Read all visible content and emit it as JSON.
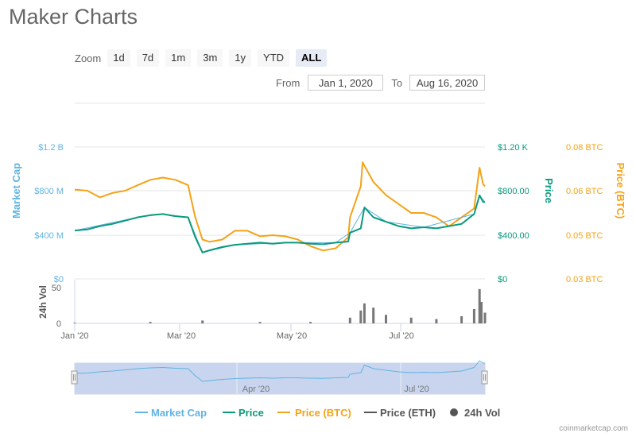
{
  "title": "Maker Charts",
  "zoom": {
    "label": "Zoom",
    "buttons": [
      "1d",
      "7d",
      "1m",
      "3m",
      "1y",
      "YTD",
      "ALL"
    ],
    "active": "ALL"
  },
  "range": {
    "from_label": "From",
    "from_value": "Jan 1, 2020",
    "to_label": "To",
    "to_value": "Aug 16, 2020"
  },
  "colors": {
    "market_cap": "#5fb4e3",
    "price": "#0a9a7d",
    "price_btc": "#f3a317",
    "price_eth": "#555555",
    "volume": "#777777",
    "navigator_fill": "#c9d5ee"
  },
  "watermark": "coinmarketcap.com",
  "chart_data": {
    "type": "line",
    "x_tick_labels": [
      "Jan '20",
      "Mar '20",
      "May '20",
      "Jul '20"
    ],
    "navigator_tick_labels": [
      "Apr '20",
      "Jul '20"
    ],
    "axes": {
      "market_cap": {
        "label": "Market Cap",
        "ticks": [
          "$1.2 B",
          "$800 M",
          "$400 M",
          "$0"
        ],
        "range": [
          0,
          1200
        ]
      },
      "price": {
        "label": "Price",
        "ticks": [
          "$1.20 K",
          "$800.00",
          "$400.00",
          "$0"
        ],
        "range": [
          0,
          1200
        ]
      },
      "price_btc": {
        "label": "Price (BTC)",
        "ticks": [
          "0.08 BTC",
          "0.06 BTC",
          "0.05 BTC",
          "0.03 BTC"
        ]
      },
      "volume": {
        "label": "24h Vol",
        "ticks": [
          "50",
          "0"
        ]
      }
    },
    "legend": {
      "placement": "bottom",
      "items": [
        "Market Cap",
        "Price",
        "Price (BTC)",
        "Price (ETH)",
        "24h Vol"
      ]
    },
    "price": {
      "dates": [
        "Jan 1",
        "Jan 8",
        "Jan 15",
        "Jan 22",
        "Jan 29",
        "Feb 5",
        "Feb 12",
        "Feb 19",
        "Feb 26",
        "Mar 4",
        "Mar 8",
        "Mar 12",
        "Mar 16",
        "Mar 23",
        "Mar 30",
        "Apr 6",
        "Apr 13",
        "Apr 20",
        "Apr 27",
        "May 4",
        "May 11",
        "May 18",
        "May 25",
        "Jun 1",
        "Jun 2",
        "Jun 8",
        "Jun 10",
        "Jun 15",
        "Jun 22",
        "Jun 29",
        "Jul 6",
        "Jul 13",
        "Jul 20",
        "Jul 27",
        "Aug 3",
        "Aug 10",
        "Aug 13",
        "Aug 15",
        "Aug 16"
      ],
      "values": [
        440,
        450,
        480,
        500,
        530,
        560,
        580,
        590,
        570,
        560,
        380,
        240,
        260,
        290,
        310,
        320,
        330,
        320,
        330,
        330,
        320,
        315,
        330,
        340,
        420,
        460,
        650,
        560,
        520,
        480,
        460,
        470,
        460,
        480,
        500,
        590,
        760,
        700,
        700
      ]
    },
    "price_btc": {
      "dates": [
        "Jan 1",
        "Jan 8",
        "Jan 15",
        "Jan 22",
        "Jan 29",
        "Feb 5",
        "Feb 12",
        "Feb 19",
        "Feb 26",
        "Mar 4",
        "Mar 8",
        "Mar 12",
        "Mar 16",
        "Mar 23",
        "Mar 30",
        "Apr 6",
        "Apr 13",
        "Apr 20",
        "Apr 27",
        "May 4",
        "May 11",
        "May 18",
        "May 25",
        "Jun 1",
        "Jun 2",
        "Jun 8",
        "Jun 9",
        "Jun 15",
        "Jun 22",
        "Jun 29",
        "Jul 6",
        "Jul 13",
        "Jul 20",
        "Jul 27",
        "Aug 3",
        "Aug 10",
        "Aug 13",
        "Aug 15",
        "Aug 16"
      ],
      "values": [
        0.0605,
        0.06,
        0.0585,
        0.0595,
        0.06,
        0.0625,
        0.065,
        0.066,
        0.065,
        0.0625,
        0.054,
        0.048,
        0.047,
        0.048,
        0.051,
        0.051,
        0.0495,
        0.05,
        0.0495,
        0.048,
        0.045,
        0.043,
        0.044,
        0.049,
        0.054,
        0.062,
        0.073,
        0.064,
        0.059,
        0.057,
        0.055,
        0.055,
        0.054,
        0.052,
        0.054,
        0.056,
        0.0705,
        0.063,
        0.062
      ]
    },
    "market_cap": {
      "dates": [
        "Jan 1",
        "Feb 5",
        "Feb 19",
        "Mar 4",
        "Mar 12",
        "Mar 30",
        "Apr 27",
        "May 25",
        "Jun 2",
        "Jun 10",
        "Jun 22",
        "Jul 13",
        "Aug 10",
        "Aug 13",
        "Aug 16"
      ],
      "values": [
        440,
        560,
        590,
        560,
        240,
        310,
        330,
        330,
        420,
        650,
        520,
        470,
        590,
        760,
        700
      ]
    },
    "volume": {
      "dates": [
        "Jan 1",
        "Feb 12",
        "Mar 12",
        "Apr 13",
        "May 11",
        "Jun 2",
        "Jun 8",
        "Jun 10",
        "Jun 15",
        "Jun 22",
        "Jul 6",
        "Jul 20",
        "Aug 3",
        "Aug 10",
        "Aug 13",
        "Aug 14",
        "Aug 16"
      ],
      "values": [
        1,
        2,
        4,
        2,
        2,
        8,
        18,
        28,
        22,
        12,
        8,
        6,
        10,
        20,
        48,
        30,
        15
      ]
    }
  }
}
